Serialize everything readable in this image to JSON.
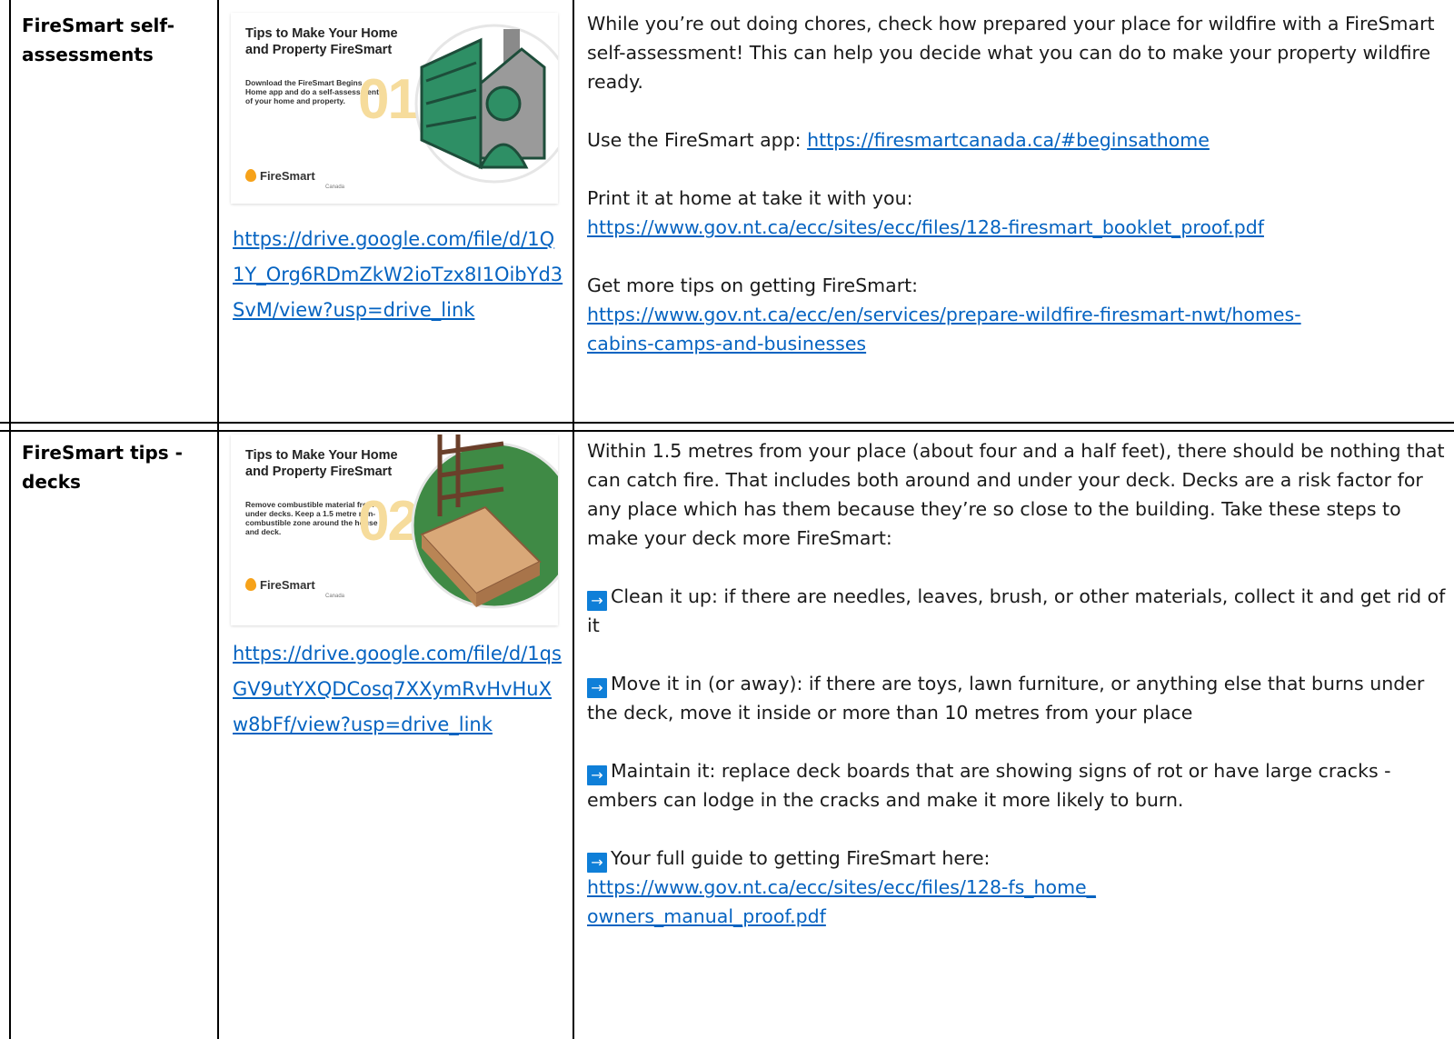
{
  "colors": {
    "link": "#0563c1",
    "arrow_bg": "#0f7fd8",
    "rule": "#000000"
  },
  "rows": [
    {
      "title": "FireSmart self-assessments",
      "thumb": {
        "title": "Tips to Make Your Home and Property FireSmart",
        "desc": "Download the FireSmart Begins at Home app and do a self-assessment of your home and property.",
        "number": "01",
        "brand": "FireSmart",
        "brand_sub": "Canada",
        "icon": "house-tree-person-icon"
      },
      "drive_link": "https://drive.google.com/file/d/1Q1Y_Org6RDmZkW2ioTzx8I1OibYd3SvM/view?usp=drive_link",
      "intro": "While you’re out doing chores, check how prepared your place for wildfire with a FireSmart self-assessment! This can help you decide what you can do to make your property wildfire ready.",
      "app_label": "Use the FireSmart app: ",
      "app_link": "https://firesmartcanada.ca/#beginsathome",
      "print_label": "Print it at home at take it with you:",
      "print_link": "https://www.gov.nt.ca/ecc/sites/ecc/files/128-firesmart_booklet_proof.pdf",
      "tips_label": "Get more tips on getting FireSmart:",
      "tips_link": "https://www.gov.nt.ca/ecc/en/services/prepare-wildfire-firesmart-nwt/homes-cabins-camps-and-businesses"
    },
    {
      "title": "FireSmart tips - decks",
      "thumb": {
        "title": "Tips to Make Your Home and Property FireSmart",
        "desc": "Remove combustible material from under decks. Keep a 1.5 metre non-combustible zone around the house and deck.",
        "number": "02",
        "brand": "FireSmart",
        "brand_sub": "Canada",
        "icon": "deck-icon"
      },
      "drive_link": "https://drive.google.com/file/d/1qsGV9utYXQDCosq7XXymRvHvHuXw8bFf/view?usp=drive_link",
      "intro": "Within 1.5 metres from your place (about four and a half feet), there should be nothing that can catch fire. That includes both around and under your deck. Decks are a risk factor for any place which has them because they’re so close to the building. Take these steps to make your deck more FireSmart:",
      "arrow": "→",
      "steps": [
        "Clean it up: if there are needles, leaves, brush, or other materials, collect it and get rid of it",
        "Move it in (or away): if there are toys, lawn furniture, or anything else that burns under the deck, move it inside or more than 10 metres from your place",
        "Maintain it: replace deck boards that are showing signs of rot or have large cracks - embers can lodge in the cracks and make it more likely to burn."
      ],
      "guide_label": "Your full guide to getting FireSmart here:",
      "guide_link": "https://www.gov.nt.ca/ecc/sites/ecc/files/128-fs_home_owners_manual_proof.pdf"
    }
  ]
}
